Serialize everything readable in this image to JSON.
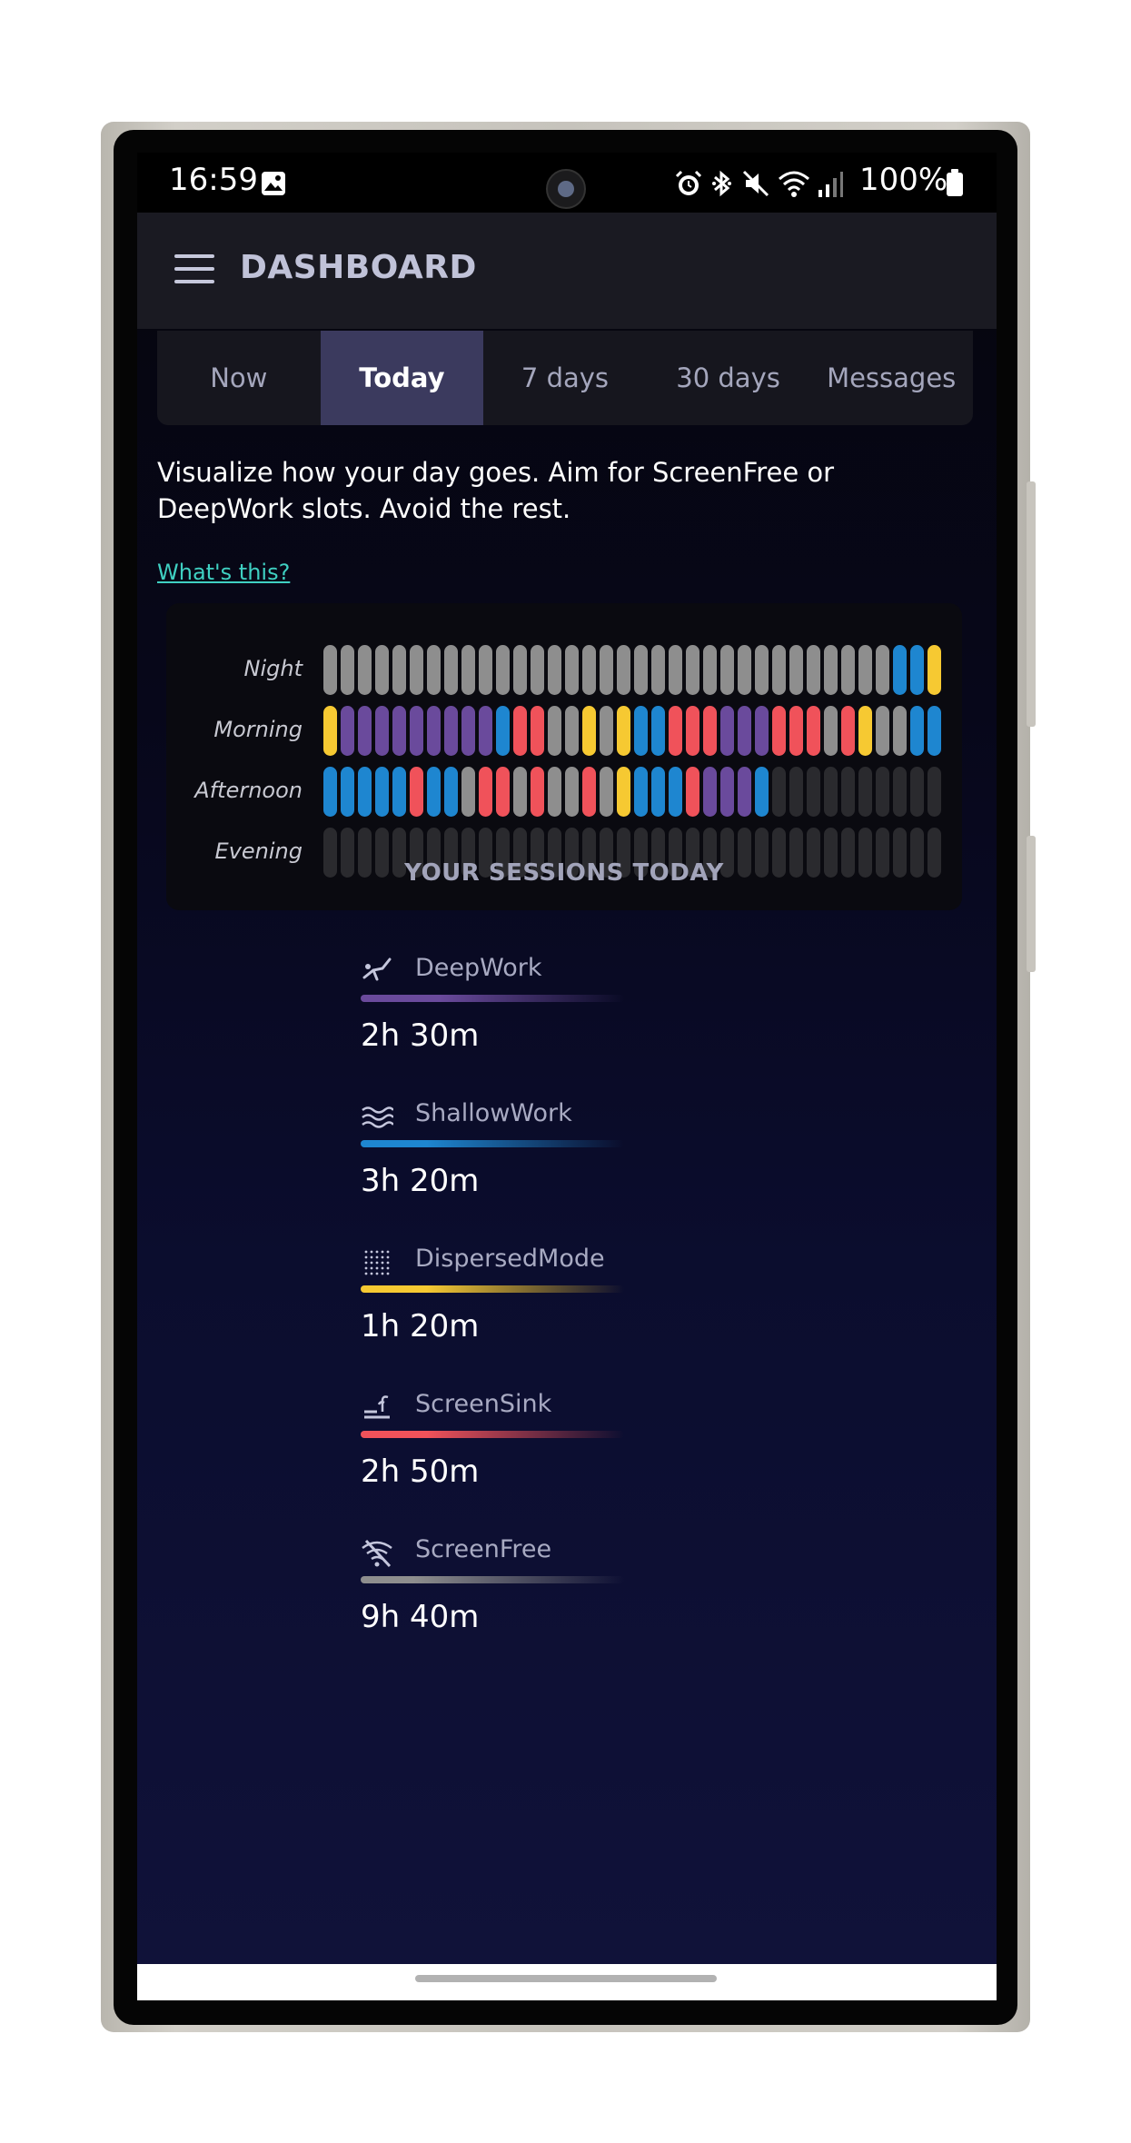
{
  "status_bar": {
    "time": "16:59",
    "battery": "100%",
    "icons": [
      "image-icon",
      "alarm-icon",
      "bluetooth-icon",
      "mute-icon",
      "wifi-icon",
      "signal-icon",
      "battery-icon"
    ]
  },
  "app_bar": {
    "title": "DASHBOARD",
    "menu_icon": "hamburger-menu-icon"
  },
  "tabs": [
    {
      "label": "Now",
      "active": false
    },
    {
      "label": "Today",
      "active": true
    },
    {
      "label": "7 days",
      "active": false
    },
    {
      "label": "30 days",
      "active": false
    },
    {
      "label": "Messages",
      "active": false
    }
  ],
  "intro": {
    "text": "Visualize how your day goes. Aim for ScreenFree or DeepWork slots. Avoid the rest.",
    "link": "What's this?"
  },
  "sessions": {
    "caption": "YOUR SESSIONS TODAY",
    "rows": [
      {
        "label": "Night",
        "slots": "GGGGGGGGGGGGGGGGGGGGGGGGGGGGGGGGGBBY"
      },
      {
        "label": "Morning",
        "slots": "YPPPPPPPPPBRRGGYGYBBRRRPPPRRRGRYGGBB"
      },
      {
        "label": "Afternoon",
        "slots": "BBBBBRBBGRRGRGGRGYBBBRPPPBEEEEEEEEEE"
      },
      {
        "label": "Evening",
        "slots": "EEEEEEEEEEEEEEEEEEEEEEEEEEEEEEEEEEEE"
      }
    ],
    "slot_colors": {
      "G": "#8e8e8e",
      "B": "#1e86d0",
      "Y": "#f6c932",
      "P": "#6a4a9c",
      "R": "#f0525a",
      "E": "#2a2a2e"
    }
  },
  "legend": [
    {
      "name": "DeepWork",
      "value": "2h 30m",
      "icon": "diving-person-icon",
      "color": "#6a4a9c"
    },
    {
      "name": "ShallowWork",
      "value": "3h 20m",
      "icon": "waves-icon",
      "color": "#1e86d0"
    },
    {
      "name": "DispersedMode",
      "value": "1h 20m",
      "icon": "dots-grid-icon",
      "color": "#f6c932"
    },
    {
      "name": "ScreenSink",
      "value": "2h 50m",
      "icon": "sink-faucet-icon",
      "color": "#f0525a"
    },
    {
      "name": "ScreenFree",
      "value": "9h 40m",
      "icon": "wifi-off-icon",
      "color": "#8e8e8e"
    }
  ]
}
